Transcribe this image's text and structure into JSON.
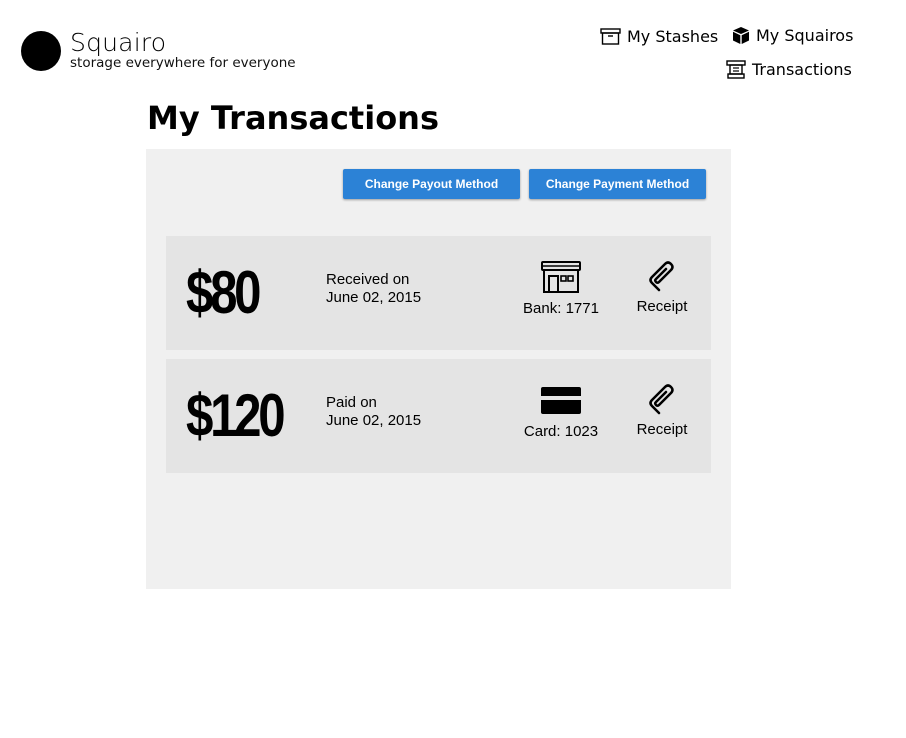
{
  "brand": {
    "name": "Squairo",
    "tagline": "storage everywhere for everyone"
  },
  "nav": {
    "stashes": {
      "label": "My Stashes",
      "icon": "archive-box-icon"
    },
    "squairos": {
      "label": "My Squairos",
      "icon": "cube-icon"
    },
    "transactions": {
      "label": "Transactions",
      "icon": "register-icon"
    }
  },
  "page": {
    "title": "My Transactions"
  },
  "actions": {
    "change_payout": "Change Payout Method",
    "change_payment": "Change Payment Method"
  },
  "transactions": [
    {
      "amount": "$80",
      "status": "Received on",
      "date": "June 02, 2015",
      "method_icon": "bank-storefront-icon",
      "method_label": "Bank: 1771",
      "receipt_label": "Receipt"
    },
    {
      "amount": "$120",
      "status": "Paid on",
      "date": "June 02, 2015",
      "method_icon": "credit-card-icon",
      "method_label": "Card: 1023",
      "receipt_label": "Receipt"
    }
  ],
  "colors": {
    "button": "#2c82d6",
    "panel": "#f0f0f0",
    "card": "#e4e4e4"
  }
}
